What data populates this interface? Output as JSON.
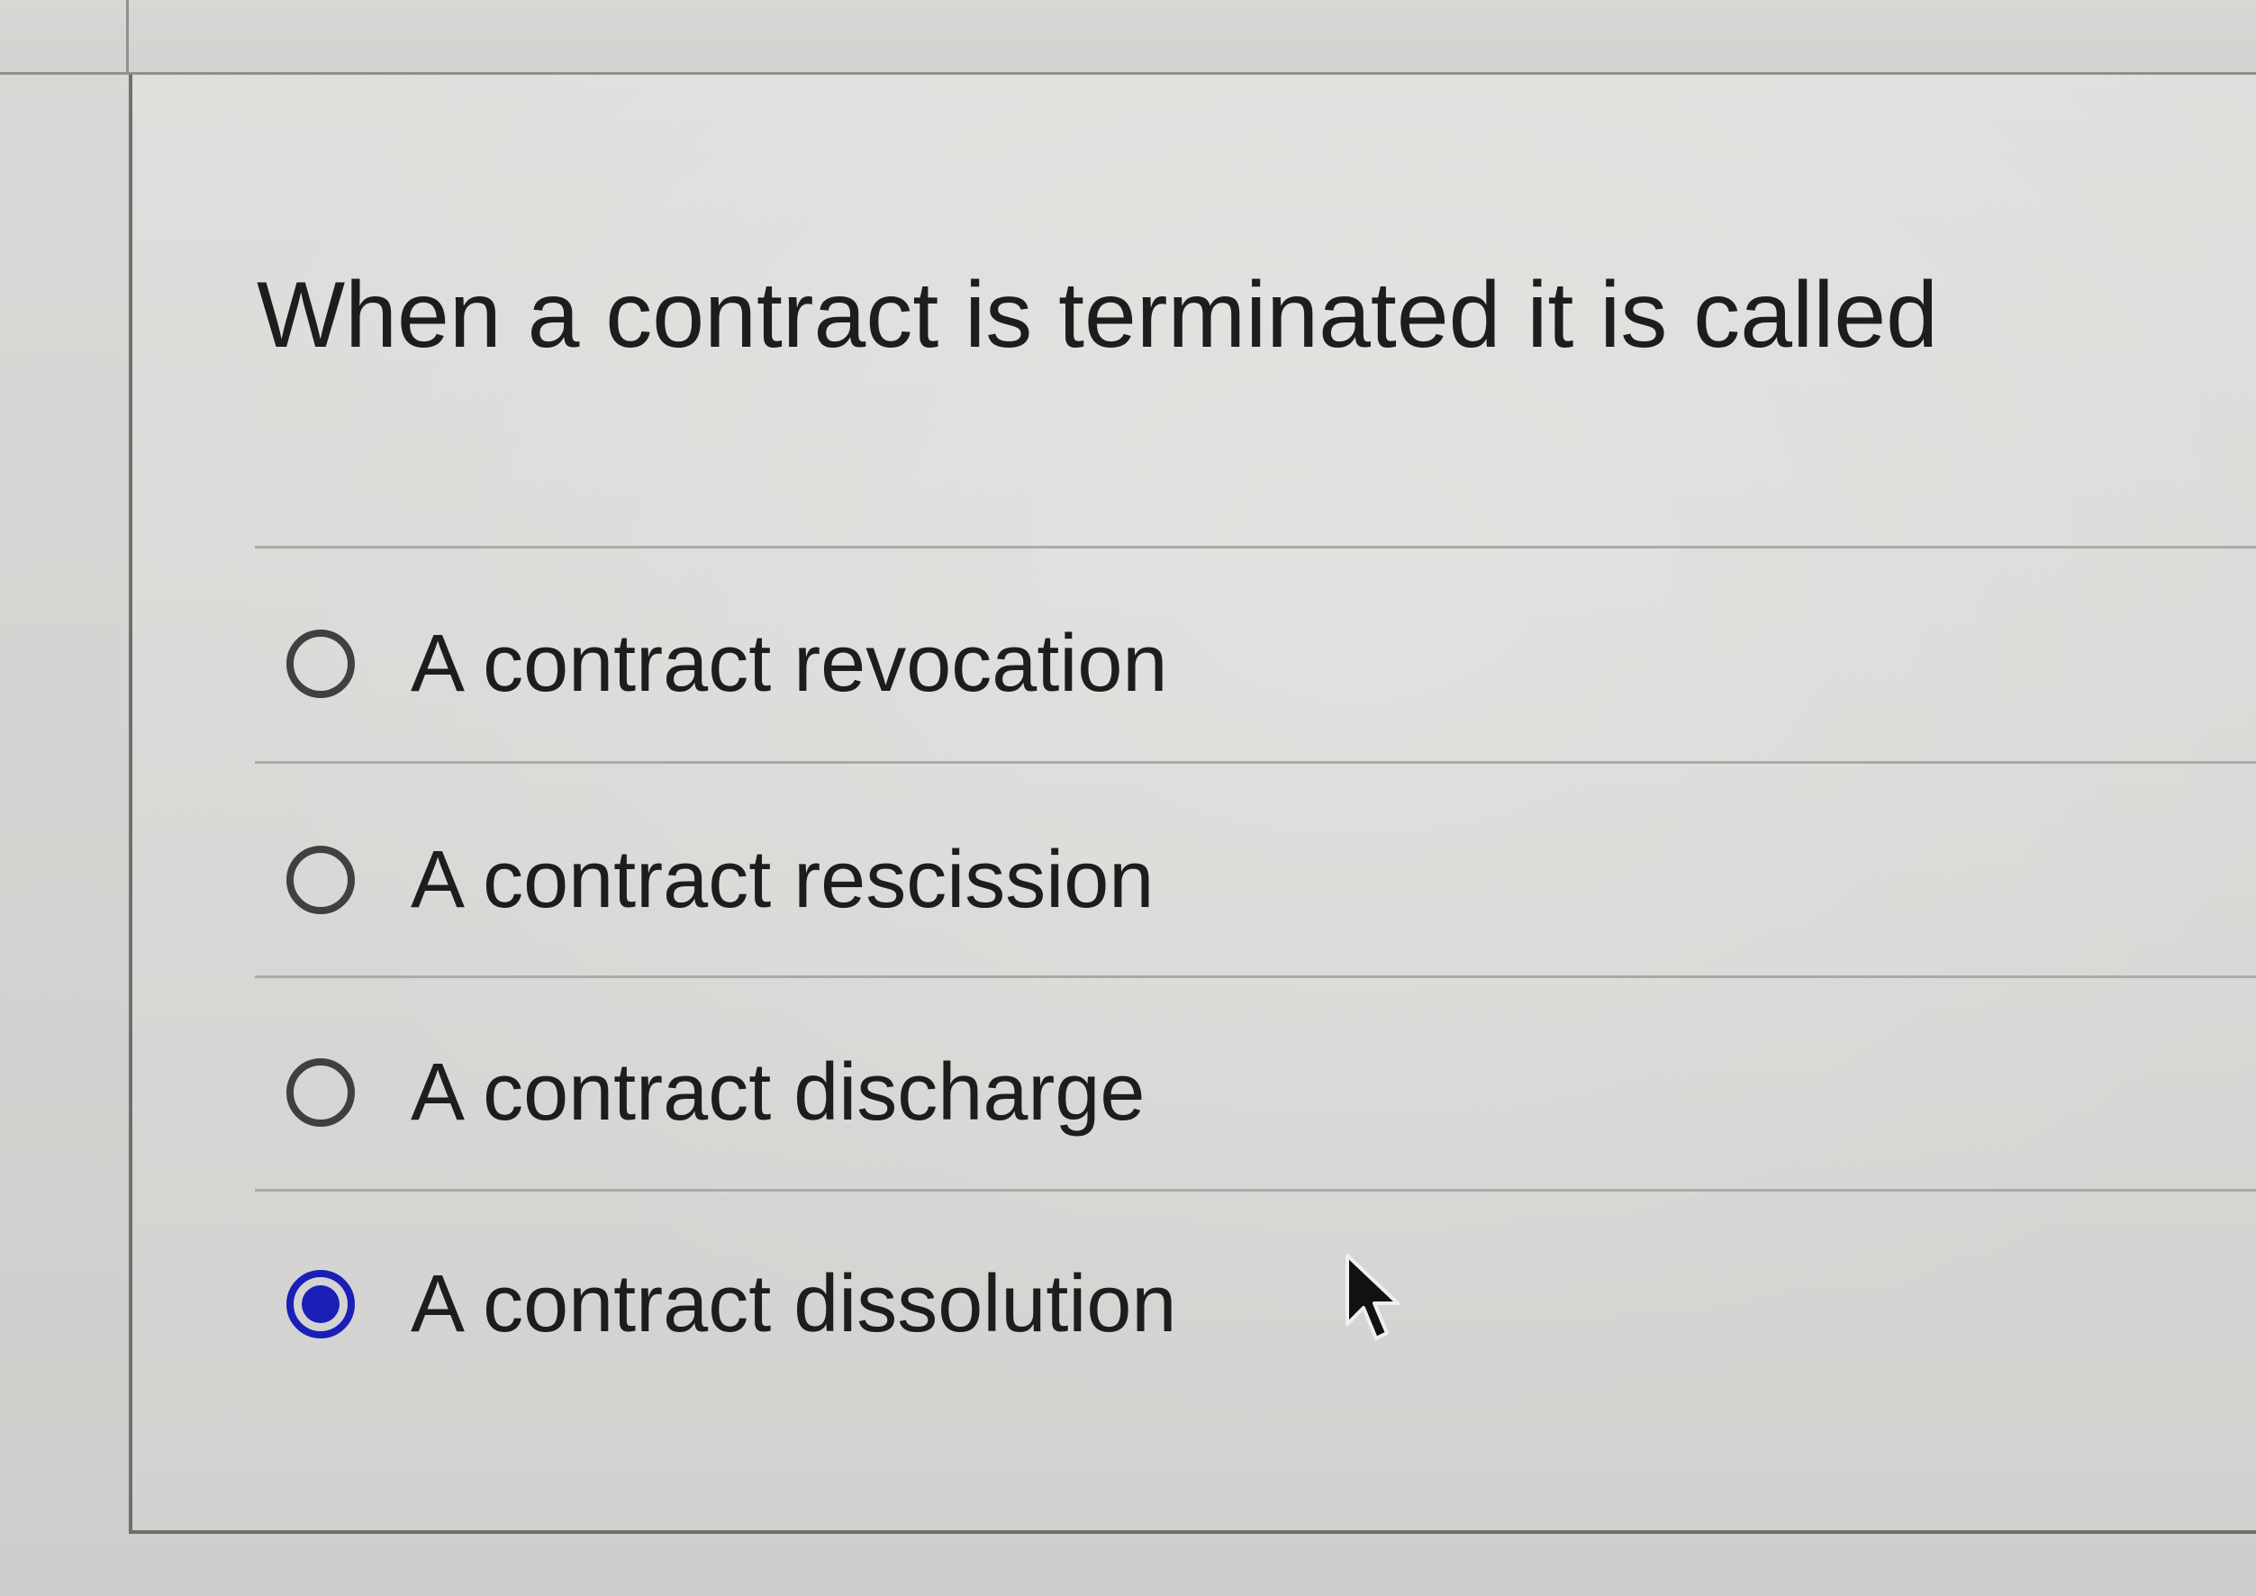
{
  "question": {
    "text": "When a contract is terminated it is called"
  },
  "options": [
    {
      "label": "A contract revocation",
      "selected": false
    },
    {
      "label": "A contract rescission",
      "selected": false
    },
    {
      "label": "A contract discharge",
      "selected": false
    },
    {
      "label": "A contract dissolution",
      "selected": true
    }
  ],
  "colors": {
    "selected_radio": "#1a1fb7",
    "unselected_radio": "#404040",
    "text": "#1d1d1d"
  },
  "icons": {
    "cursor": "mouse-pointer-arrow"
  }
}
